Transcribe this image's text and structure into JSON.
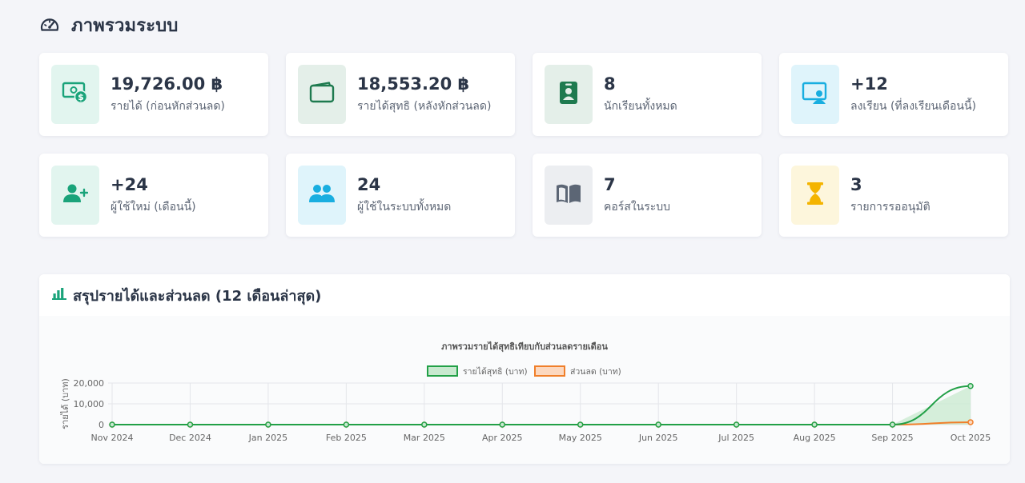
{
  "header": {
    "title": "ภาพรวมระบบ",
    "icon": "speedometer-icon"
  },
  "stats": [
    {
      "value": "19,726.00 ฿",
      "label": "รายได้ (ก่อนหักส่วนลด)",
      "icon": "money-icon",
      "color": "#1aa37a",
      "bg": "#e2f5ef"
    },
    {
      "value": "18,553.20 ฿",
      "label": "รายได้สุทธิ (หลังหักส่วนลด)",
      "icon": "wallet-icon",
      "color": "#1e7a4f",
      "bg": "#e4efe9"
    },
    {
      "value": "8",
      "label": "นักเรียนทั้งหมด",
      "icon": "id-badge-icon",
      "color": "#1e7a4f",
      "bg": "#e4efe9"
    },
    {
      "value": "+12",
      "label": "ลงเรียน (ที่ลงเรียนเดือนนี้)",
      "icon": "teacher-icon",
      "color": "#19aee0",
      "bg": "#dff4fb"
    },
    {
      "value": "+24",
      "label": "ผู้ใช้ใหม่ (เดือนนี้)",
      "icon": "user-plus-icon",
      "color": "#1aa37a",
      "bg": "#e2f5ef"
    },
    {
      "value": "24",
      "label": "ผู้ใช้ในระบบทั้งหมด",
      "icon": "users-icon",
      "color": "#19aee0",
      "bg": "#dff4fb"
    },
    {
      "value": "7",
      "label": "คอร์สในระบบ",
      "icon": "book-icon",
      "color": "#5c6675",
      "bg": "#eceef1"
    },
    {
      "value": "3",
      "label": "รายการรออนุมัติ",
      "icon": "hourglass-icon",
      "color": "#f4b400",
      "bg": "#fdf6dc"
    }
  ],
  "chart_section": {
    "heading": "สรุปรายได้และส่วนลด (12 เดือนล่าสุด)",
    "icon": "bar-chart-icon"
  },
  "chart_data": {
    "type": "line",
    "title": "ภาพรวมรายได้สุทธิเทียบกับส่วนลดรายเดือน",
    "ylabel": "รายได้ (บาท)",
    "xlabel": "",
    "categories": [
      "Nov 2024",
      "Dec 2024",
      "Jan 2025",
      "Feb 2025",
      "Mar 2025",
      "Apr 2025",
      "May 2025",
      "Jun 2025",
      "Jul 2025",
      "Aug 2025",
      "Sep 2025",
      "Oct 2025"
    ],
    "yticks": [
      "0",
      "10,000",
      "20,000"
    ],
    "ylim": [
      0,
      20000
    ],
    "grid": true,
    "legend": "top",
    "series": [
      {
        "name": "รายได้สุทธิ (บาท)",
        "values": [
          0,
          0,
          0,
          0,
          0,
          0,
          0,
          0,
          0,
          0,
          0,
          18553.2
        ],
        "color": "#22a047",
        "fill": "#c8e9cf"
      },
      {
        "name": "ส่วนลด (บาท)",
        "values": [
          0,
          0,
          0,
          0,
          0,
          0,
          0,
          0,
          0,
          0,
          0,
          1172.8
        ],
        "color": "#f07f2a",
        "fill": "#fcd8bf"
      }
    ]
  }
}
